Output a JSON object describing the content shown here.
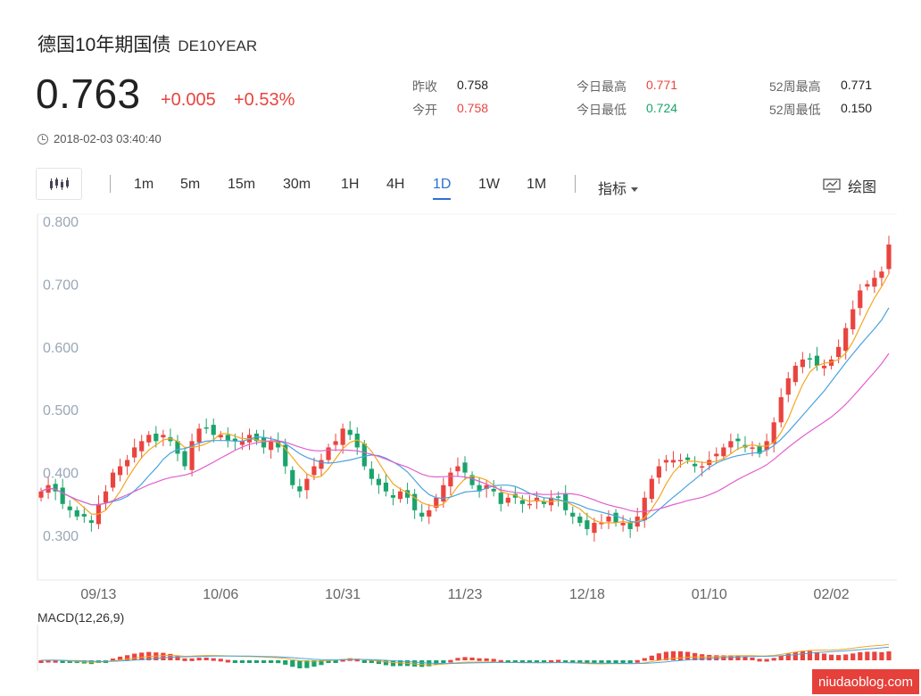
{
  "header": {
    "title": "德国10年期国债",
    "code": "DE10YEAR",
    "price": "0.763",
    "change": "+0.005",
    "change_pct": "+0.53%",
    "timestamp": "2018-02-03 03:40:40"
  },
  "stats": {
    "prev_close_label": "昨收",
    "prev_close": "0.758",
    "open_label": "今开",
    "open": "0.758",
    "day_high_label": "今日最高",
    "day_high": "0.771",
    "day_low_label": "今日最低",
    "day_low": "0.724",
    "w52_high_label": "52周最高",
    "w52_high": "0.771",
    "w52_low_label": "52周最低",
    "w52_low": "0.150"
  },
  "toolbar": {
    "timeframes": [
      "1m",
      "5m",
      "15m",
      "30m",
      "1H",
      "4H",
      "1D",
      "1W",
      "1M"
    ],
    "active": "1D",
    "indicators_label": "指标",
    "draw_label": "绘图"
  },
  "colors": {
    "up": "#e9443f",
    "down": "#1aa36b",
    "ma5": "#f5a623",
    "ma10": "#4aa3df",
    "ma20": "#e05fd0",
    "macd_dif": "#f5a623",
    "macd_dea": "#4aa3df"
  },
  "chart_data": {
    "type": "candlestick",
    "ylim": [
      0.3,
      0.8
    ],
    "y_ticks": [
      "0.800",
      "0.700",
      "0.600",
      "0.500",
      "0.400",
      "0.300"
    ],
    "x_tick_labels": [
      "09/13",
      "10/06",
      "10/31",
      "11/23",
      "12/18",
      "01/10",
      "02/02"
    ],
    "x_tick_index": [
      8,
      25,
      42,
      59,
      76,
      93,
      110
    ],
    "close": [
      0.37,
      0.38,
      0.37,
      0.35,
      0.34,
      0.33,
      0.33,
      0.32,
      0.35,
      0.37,
      0.4,
      0.41,
      0.42,
      0.44,
      0.45,
      0.46,
      0.45,
      0.46,
      0.45,
      0.43,
      0.41,
      0.45,
      0.47,
      0.47,
      0.46,
      0.46,
      0.45,
      0.45,
      0.45,
      0.46,
      0.45,
      0.44,
      0.45,
      0.44,
      0.41,
      0.38,
      0.37,
      0.39,
      0.41,
      0.42,
      0.44,
      0.45,
      0.47,
      0.46,
      0.44,
      0.41,
      0.39,
      0.38,
      0.37,
      0.36,
      0.37,
      0.36,
      0.34,
      0.33,
      0.34,
      0.36,
      0.38,
      0.4,
      0.41,
      0.4,
      0.38,
      0.37,
      0.38,
      0.37,
      0.35,
      0.36,
      0.36,
      0.35,
      0.35,
      0.36,
      0.35,
      0.36,
      0.36,
      0.34,
      0.33,
      0.32,
      0.31,
      0.32,
      0.32,
      0.33,
      0.32,
      0.32,
      0.31,
      0.33,
      0.36,
      0.39,
      0.41,
      0.42,
      0.42,
      0.42,
      0.42,
      0.41,
      0.41,
      0.42,
      0.43,
      0.44,
      0.45,
      0.45,
      0.44,
      0.44,
      0.43,
      0.45,
      0.48,
      0.52,
      0.55,
      0.57,
      0.58,
      0.58,
      0.57,
      0.57,
      0.58,
      0.6,
      0.63,
      0.66,
      0.69,
      0.7,
      0.71,
      0.72,
      0.763
    ],
    "macd": {
      "label": "MACD(12,26,9)"
    },
    "ma": [
      "MA5",
      "MA10",
      "MA20"
    ]
  },
  "watermark": "niudaoblog.com"
}
